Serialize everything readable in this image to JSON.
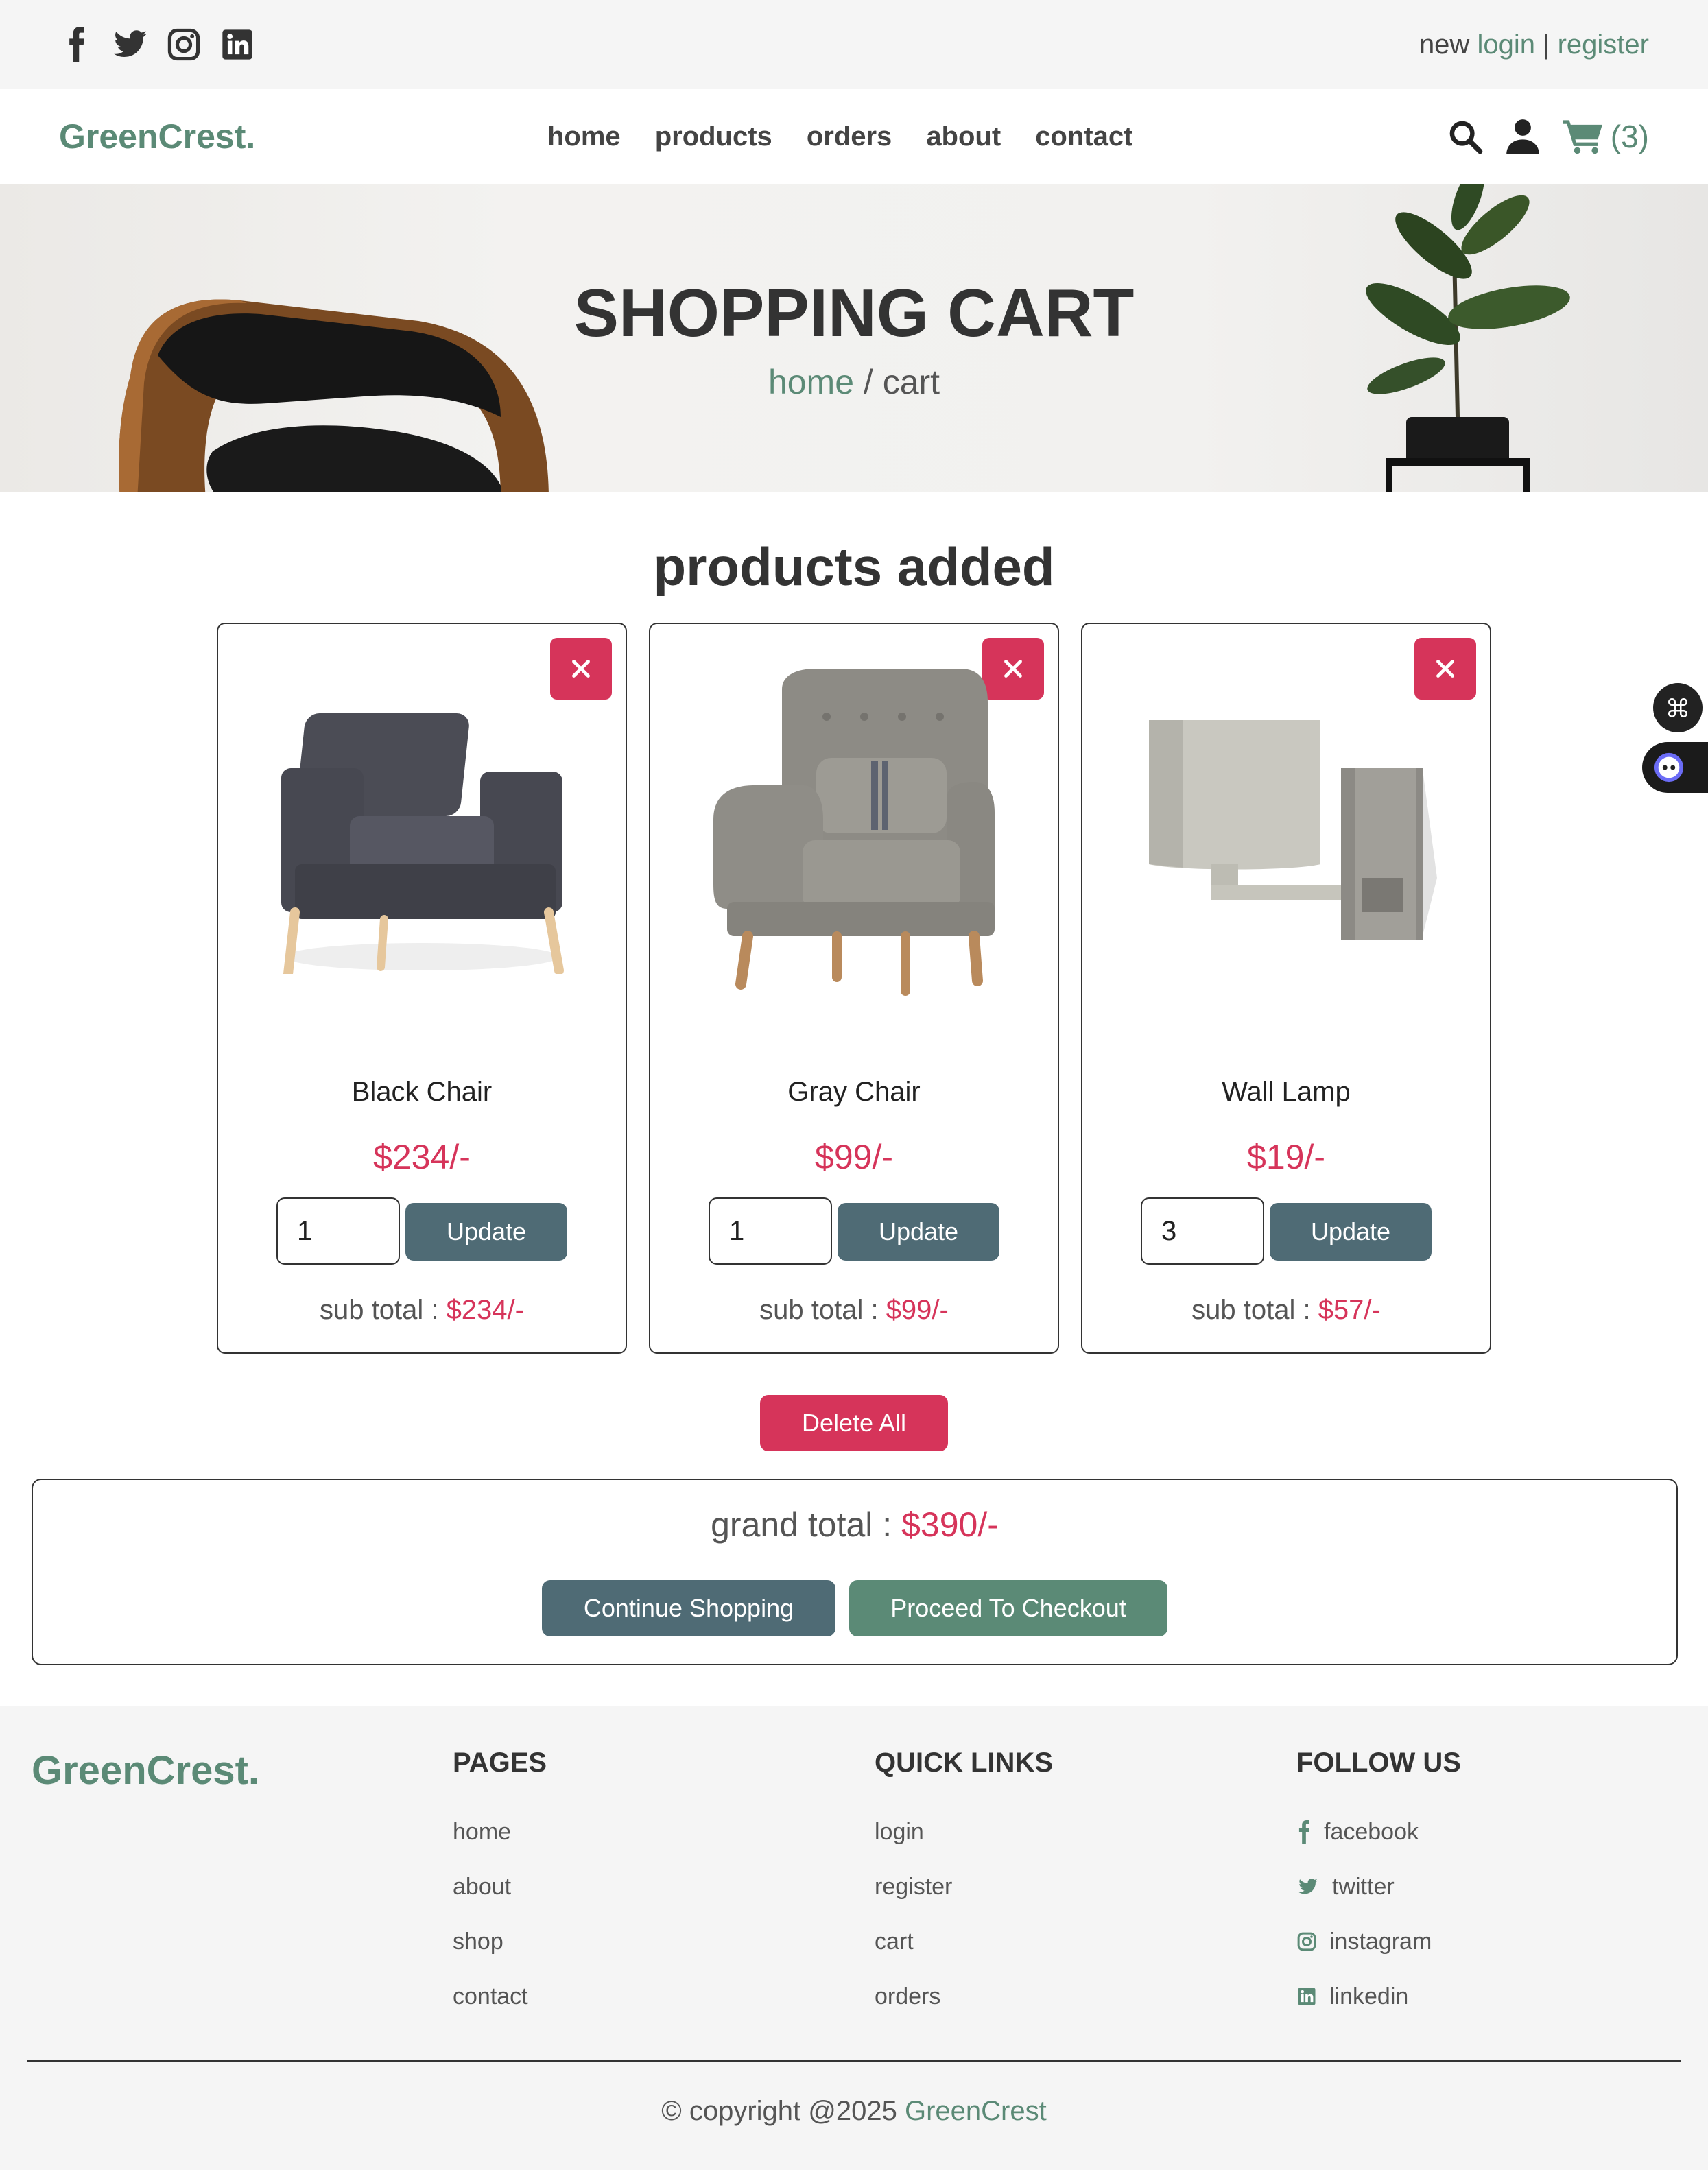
{
  "topbar": {
    "socials": [
      "facebook-icon",
      "twitter-icon",
      "instagram-icon",
      "linkedin-icon"
    ],
    "auth_prefix": "new",
    "login": "login",
    "separator": "|",
    "register": "register"
  },
  "header": {
    "logo": "GreenCrest.",
    "nav": [
      "home",
      "products",
      "orders",
      "about",
      "contact"
    ],
    "cart_count": "(3)"
  },
  "hero": {
    "title": "SHOPPING CART",
    "crumb_home": "home",
    "crumb_rest": "/ cart"
  },
  "main": {
    "section_title": "products added",
    "products": [
      {
        "name": "Black Chair",
        "price": "$234/-",
        "qty": "1",
        "update": "Update",
        "subtotal_label": "sub total :",
        "subtotal": "$234/-"
      },
      {
        "name": "Gray Chair",
        "price": "$99/-",
        "qty": "1",
        "update": "Update",
        "subtotal_label": "sub total :",
        "subtotal": "$99/-"
      },
      {
        "name": "Wall Lamp",
        "price": "$19/-",
        "qty": "3",
        "update": "Update",
        "subtotal_label": "sub total :",
        "subtotal": "$57/-"
      }
    ],
    "delete_all": "Delete All",
    "grand_label": "grand total :",
    "grand_total": "$390/-",
    "continue": "Continue Shopping",
    "checkout": "Proceed To Checkout"
  },
  "footer": {
    "logo": "GreenCrest.",
    "pages_title": "PAGES",
    "pages": [
      "home",
      "about",
      "shop",
      "contact"
    ],
    "quick_title": "QUICK LINKS",
    "quick": [
      "login",
      "register",
      "cart",
      "orders"
    ],
    "follow_title": "FOLLOW US",
    "follow": [
      "facebook",
      "twitter",
      "instagram",
      "linkedin"
    ],
    "copyright": "© copyright @2025",
    "brand": "GreenCrest"
  },
  "colors": {
    "accent": "#5b8a76",
    "danger": "#d6345a",
    "slate": "#4f6b75",
    "bg_light": "#f5f5f5"
  }
}
